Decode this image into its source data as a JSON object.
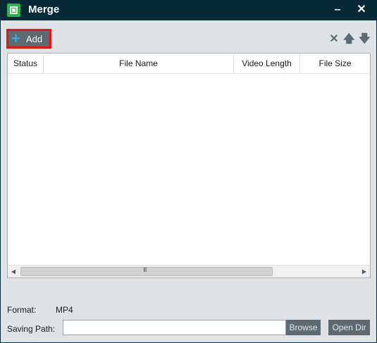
{
  "window": {
    "title": "Merge",
    "minimize_glyph": "–",
    "close_glyph": "✕",
    "app_icon": "merge-app-icon"
  },
  "toolbar": {
    "add_label": "Add",
    "add_icon": "plus-icon",
    "remove_icon": "x-icon",
    "move_up_icon": "arrow-up-icon",
    "move_down_icon": "arrow-down-icon"
  },
  "file_list": {
    "columns": [
      "Status",
      "File Name",
      "Video Length",
      "File Size"
    ],
    "rows": []
  },
  "scrollbar": {
    "grip": "III"
  },
  "footer": {
    "format_label": "Format:",
    "format_value": "MP4",
    "saving_path_label": "Saving Path:",
    "saving_path_value": "",
    "browse_label": "Browse",
    "open_dir_label": "Open Dir"
  },
  "colors": {
    "titlebar": "#062a36",
    "client_bg": "#dfe3e6",
    "button_bg": "#5d6a72",
    "highlight_border": "#e01717",
    "plus_accent": "#36a9e1",
    "app_icon_green": "#29b34a"
  }
}
